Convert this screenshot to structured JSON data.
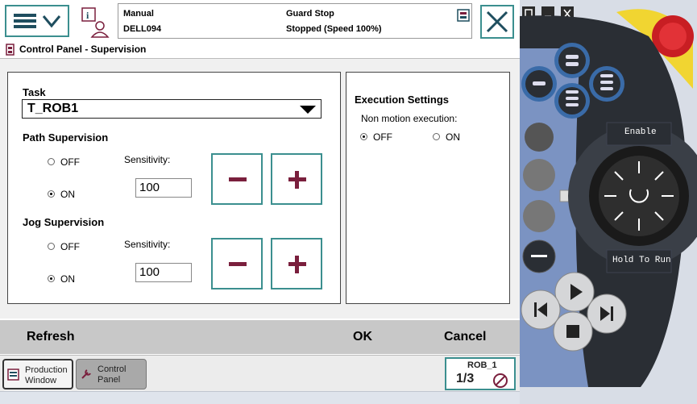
{
  "header": {
    "mode": "Manual",
    "controller": "DELL094",
    "guard": "Guard Stop",
    "state": "Stopped (Speed 100%)"
  },
  "page_title": "Control Panel - Supervision",
  "task": {
    "label": "Task",
    "value": "T_ROB1"
  },
  "path_supervision": {
    "title": "Path Supervision",
    "off_label": "OFF",
    "on_label": "ON",
    "selected": "ON",
    "sensitivity_label": "Sensitivity:",
    "sensitivity_value": "100"
  },
  "jog_supervision": {
    "title": "Jog Supervision",
    "off_label": "OFF",
    "on_label": "ON",
    "selected": "ON",
    "sensitivity_label": "Sensitivity:",
    "sensitivity_value": "100"
  },
  "execution_settings": {
    "title": "Execution Settings",
    "nonmotion_label": "Non motion execution:",
    "off_label": "OFF",
    "on_label": "ON",
    "selected": "OFF"
  },
  "bottom": {
    "refresh": "Refresh",
    "ok": "OK",
    "cancel": "Cancel"
  },
  "taskbar": {
    "production_window": "Production Window",
    "control_panel": "Control Panel",
    "robot": "ROB_1",
    "fraction": "1/3"
  },
  "flexpendant": {
    "enable_label": "Enable",
    "hold_label": "Hold To Run"
  },
  "colors": {
    "accent": "#3b8f8f",
    "button_symbol": "#7a1f3d",
    "bottom_bar": "#c8c8c8"
  }
}
